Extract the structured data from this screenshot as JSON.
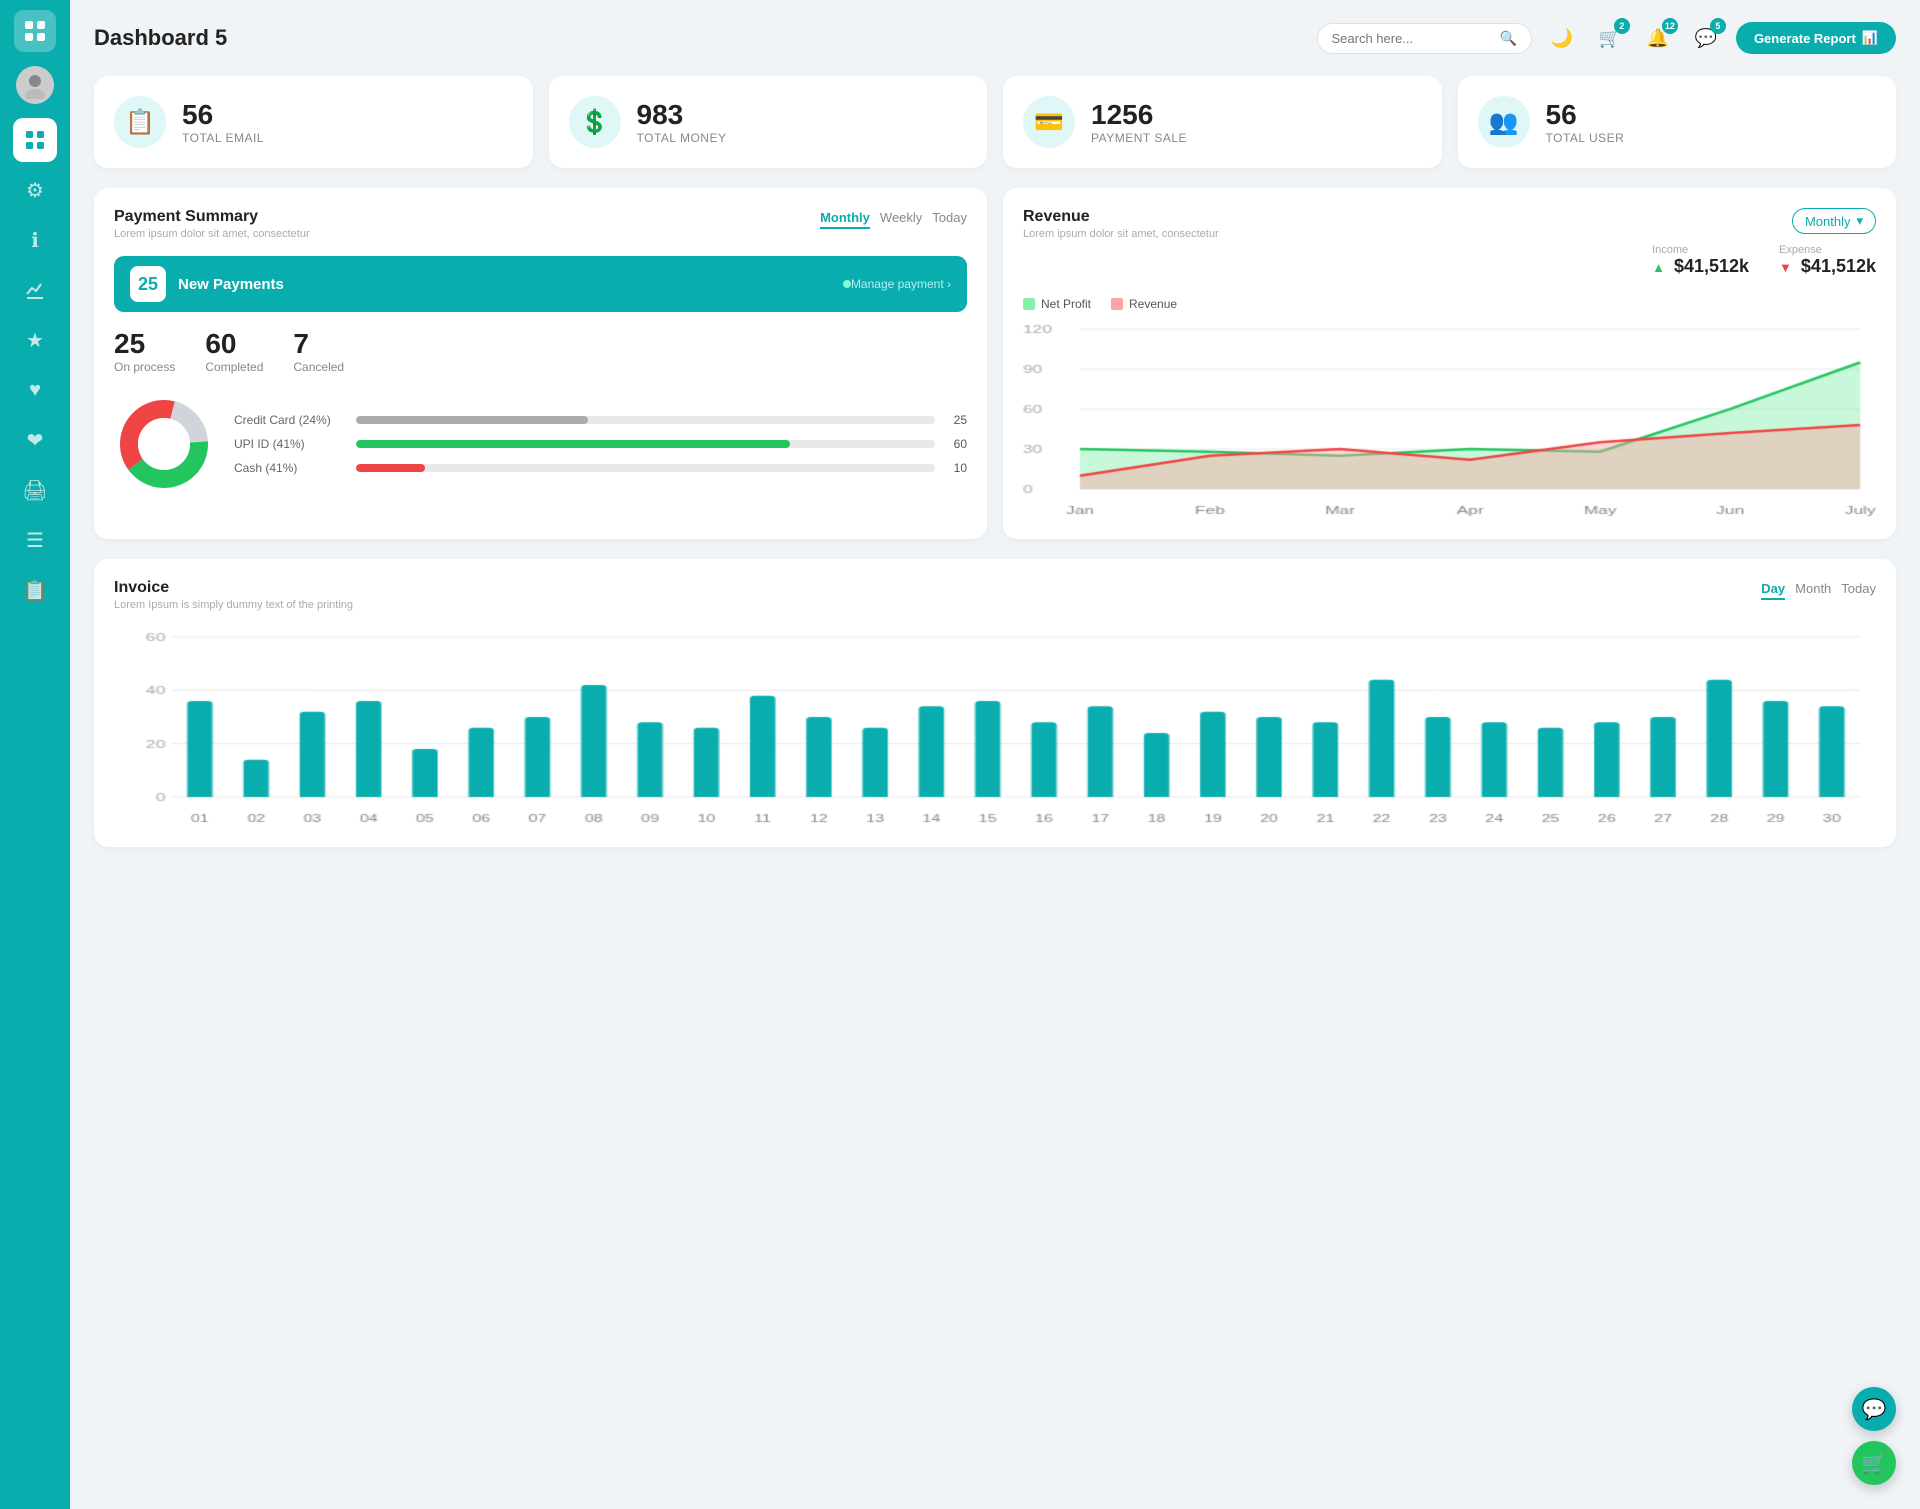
{
  "app": {
    "title": "Dashboard 5"
  },
  "header": {
    "search_placeholder": "Search here...",
    "generate_btn": "Generate Report",
    "badges": {
      "cart": "2",
      "bell": "12",
      "chat": "5"
    }
  },
  "stat_cards": [
    {
      "id": "email",
      "number": "56",
      "label": "TOTAL EMAIL",
      "icon": "📋"
    },
    {
      "id": "money",
      "number": "983",
      "label": "TOTAL MONEY",
      "icon": "💲"
    },
    {
      "id": "payment",
      "number": "1256",
      "label": "PAYMENT SALE",
      "icon": "💳"
    },
    {
      "id": "user",
      "number": "56",
      "label": "TOTAL USER",
      "icon": "👥"
    }
  ],
  "payment_summary": {
    "title": "Payment Summary",
    "subtitle": "Lorem ipsum dolor sit amet, consectetur",
    "tabs": [
      "Monthly",
      "Weekly",
      "Today"
    ],
    "active_tab": "Monthly",
    "new_payments": {
      "count": "25",
      "label": "New Payments",
      "manage_link": "Manage payment ›"
    },
    "stats": [
      {
        "num": "25",
        "label": "On process"
      },
      {
        "num": "60",
        "label": "Completed"
      },
      {
        "num": "7",
        "label": "Canceled"
      }
    ],
    "progress_bars": [
      {
        "label": "Credit Card (24%)",
        "pct": 40,
        "val": "25",
        "color": "#aaa"
      },
      {
        "label": "UPI ID (41%)",
        "pct": 75,
        "val": "60",
        "color": "#22c55e"
      },
      {
        "label": "Cash (41%)",
        "pct": 12,
        "val": "10",
        "color": "#ef4444"
      }
    ],
    "donut": {
      "segments": [
        {
          "pct": 24,
          "color": "#d1d5db"
        },
        {
          "pct": 41,
          "color": "#22c55e"
        },
        {
          "pct": 35,
          "color": "#ef4444"
        }
      ]
    }
  },
  "revenue": {
    "title": "Revenue",
    "subtitle": "Lorem ipsum dolor sit amet, consectetur",
    "dropdown_label": "Monthly",
    "income": {
      "label": "Income",
      "value": "$41,512k"
    },
    "expense": {
      "label": "Expense",
      "value": "$41,512k"
    },
    "legend": [
      {
        "label": "Net Profit",
        "color": "#86efac"
      },
      {
        "label": "Revenue",
        "color": "#fca5a5"
      }
    ],
    "chart_labels": [
      "Jan",
      "Feb",
      "Mar",
      "Apr",
      "May",
      "Jun",
      "July"
    ],
    "net_profit_data": [
      30,
      28,
      25,
      30,
      28,
      60,
      95
    ],
    "revenue_data": [
      10,
      25,
      30,
      22,
      35,
      42,
      48
    ],
    "y_labels": [
      "0",
      "30",
      "60",
      "90",
      "120"
    ]
  },
  "invoice": {
    "title": "Invoice",
    "subtitle": "Lorem Ipsum is simply dummy text of the printing",
    "tabs": [
      "Day",
      "Month",
      "Today"
    ],
    "active_tab": "Day",
    "x_labels": [
      "01",
      "02",
      "03",
      "04",
      "05",
      "06",
      "07",
      "08",
      "09",
      "10",
      "11",
      "12",
      "13",
      "14",
      "15",
      "16",
      "17",
      "18",
      "19",
      "20",
      "21",
      "22",
      "23",
      "24",
      "25",
      "26",
      "27",
      "28",
      "29",
      "30"
    ],
    "y_labels": [
      "0",
      "20",
      "40",
      "60"
    ],
    "bar_data": [
      36,
      14,
      32,
      36,
      18,
      26,
      30,
      42,
      28,
      26,
      38,
      30,
      26,
      34,
      36,
      28,
      34,
      24,
      32,
      30,
      28,
      44,
      30,
      28,
      26,
      28,
      30,
      44,
      36,
      34
    ]
  }
}
